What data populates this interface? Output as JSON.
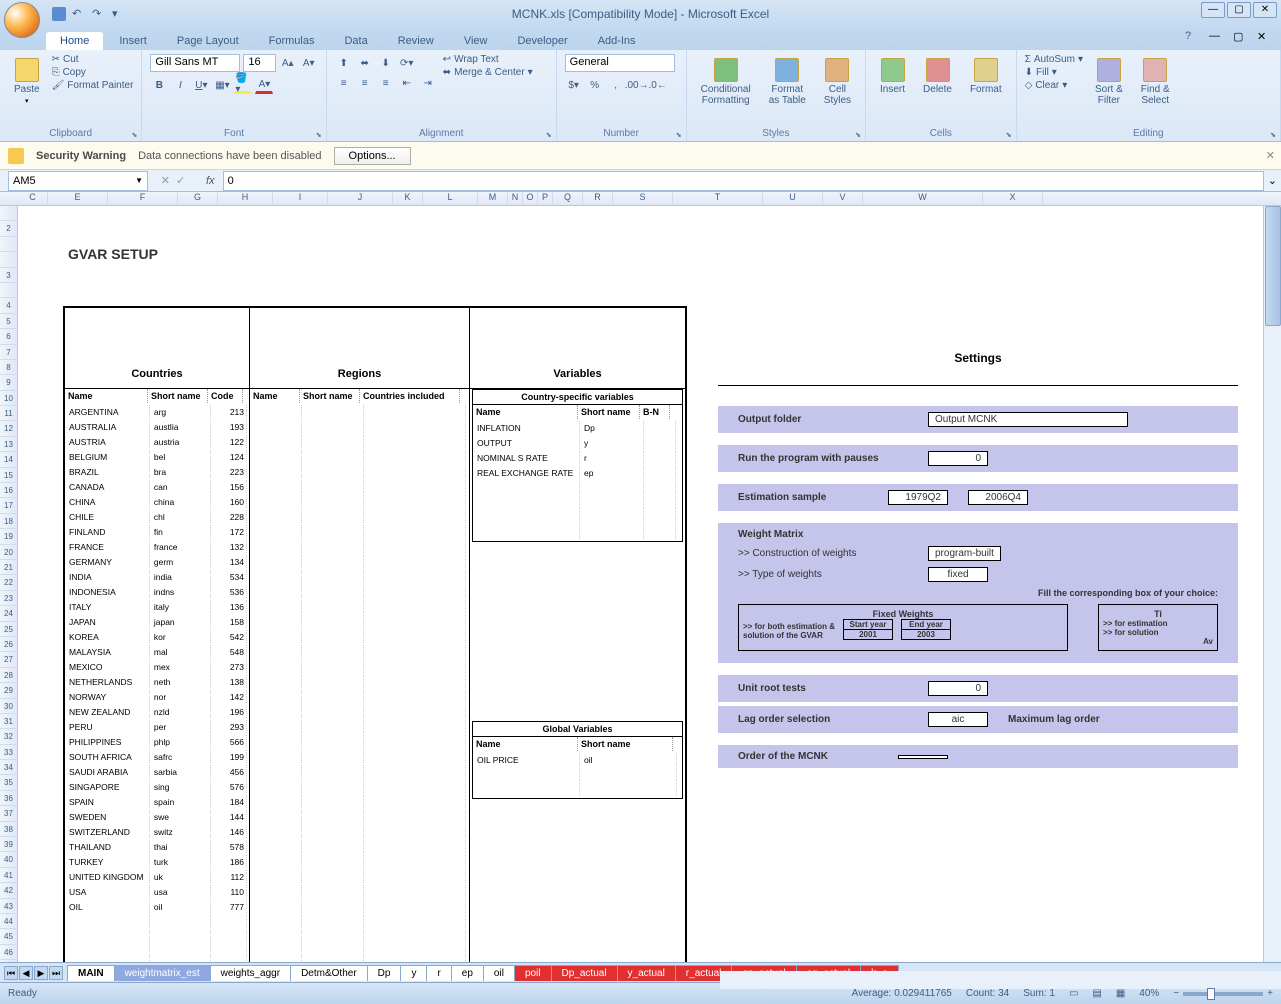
{
  "title": "MCNK.xls  [Compatibility Mode] - Microsoft Excel",
  "tabs": [
    "Home",
    "Insert",
    "Page Layout",
    "Formulas",
    "Data",
    "Review",
    "View",
    "Developer",
    "Add-Ins"
  ],
  "active_tab": "Home",
  "ribbon": {
    "clipboard": {
      "label": "Clipboard",
      "paste": "Paste",
      "cut": "Cut",
      "copy": "Copy",
      "format_painter": "Format Painter"
    },
    "font": {
      "label": "Font",
      "family": "Gill Sans MT",
      "size": "16"
    },
    "alignment": {
      "label": "Alignment",
      "wrap": "Wrap Text",
      "merge": "Merge & Center"
    },
    "number": {
      "label": "Number",
      "format": "General"
    },
    "styles": {
      "label": "Styles",
      "cond": "Conditional\nFormatting",
      "table": "Format\nas Table",
      "cell": "Cell\nStyles"
    },
    "cells": {
      "label": "Cells",
      "insert": "Insert",
      "delete": "Delete",
      "format": "Format"
    },
    "editing": {
      "label": "Editing",
      "autosum": "AutoSum",
      "fill": "Fill",
      "clear": "Clear",
      "sort": "Sort &\nFilter",
      "find": "Find &\nSelect"
    }
  },
  "security": {
    "title": "Security Warning",
    "msg": "Data connections have been disabled",
    "btn": "Options..."
  },
  "namebox": "AM5",
  "formula": "0",
  "sheet": {
    "title": "GVAR SETUP",
    "countries": {
      "header": "Countries",
      "cols": [
        "Name",
        "Short name",
        "Code"
      ],
      "rows": [
        [
          "ARGENTINA",
          "arg",
          "213"
        ],
        [
          "AUSTRALIA",
          "austlia",
          "193"
        ],
        [
          "AUSTRIA",
          "austria",
          "122"
        ],
        [
          "BELGIUM",
          "bel",
          "124"
        ],
        [
          "BRAZIL",
          "bra",
          "223"
        ],
        [
          "CANADA",
          "can",
          "156"
        ],
        [
          "CHINA",
          "china",
          "160"
        ],
        [
          "CHILE",
          "chl",
          "228"
        ],
        [
          "FINLAND",
          "fin",
          "172"
        ],
        [
          "FRANCE",
          "france",
          "132"
        ],
        [
          "GERMANY",
          "germ",
          "134"
        ],
        [
          "INDIA",
          "india",
          "534"
        ],
        [
          "INDONESIA",
          "indns",
          "536"
        ],
        [
          "ITALY",
          "italy",
          "136"
        ],
        [
          "JAPAN",
          "japan",
          "158"
        ],
        [
          "KOREA",
          "kor",
          "542"
        ],
        [
          "MALAYSIA",
          "mal",
          "548"
        ],
        [
          "MEXICO",
          "mex",
          "273"
        ],
        [
          "NETHERLANDS",
          "neth",
          "138"
        ],
        [
          "NORWAY",
          "nor",
          "142"
        ],
        [
          "NEW ZEALAND",
          "nzld",
          "196"
        ],
        [
          "PERU",
          "per",
          "293"
        ],
        [
          "PHILIPPINES",
          "phlp",
          "566"
        ],
        [
          "SOUTH AFRICA",
          "safrc",
          "199"
        ],
        [
          "SAUDI ARABIA",
          "sarbia",
          "456"
        ],
        [
          "SINGAPORE",
          "sing",
          "576"
        ],
        [
          "SPAIN",
          "spain",
          "184"
        ],
        [
          "SWEDEN",
          "swe",
          "144"
        ],
        [
          "SWITZERLAND",
          "switz",
          "146"
        ],
        [
          "THAILAND",
          "thai",
          "578"
        ],
        [
          "TURKEY",
          "turk",
          "186"
        ],
        [
          "UNITED KINGDOM",
          "uk",
          "112"
        ],
        [
          "USA",
          "usa",
          "110"
        ],
        [
          "OIL",
          "oil",
          "777"
        ]
      ]
    },
    "regions": {
      "header": "Regions",
      "cols": [
        "Name",
        "Short name",
        "Countries included"
      ]
    },
    "variables": {
      "header": "Variables",
      "cs_header": "Country-specific variables",
      "cs_cols": [
        "Name",
        "Short name",
        "B-N"
      ],
      "cs_rows": [
        [
          "INFLATION",
          "Dp"
        ],
        [
          "OUTPUT",
          "y"
        ],
        [
          "NOMINAL S RATE",
          "r"
        ],
        [
          "REAL EXCHANGE RATE",
          "ep"
        ]
      ],
      "gv_header": "Global Variables",
      "gv_cols": [
        "Name",
        "Short name"
      ],
      "gv_rows": [
        [
          "OIL PRICE",
          "oil"
        ]
      ]
    },
    "settings": {
      "header": "Settings",
      "output_folder_label": "Output folder",
      "output_folder": "Output MCNK",
      "pauses_label": "Run the program with pauses",
      "pauses": "0",
      "est_label": "Estimation sample",
      "est_start": "1979Q2",
      "est_end": "2006Q4",
      "wm_header": "Weight Matrix",
      "constr_label": ">> Construction of weights",
      "constr": "program-built",
      "type_label": ">> Type of weights",
      "type": "fixed",
      "fill_msg": "Fill the corresponding box of your choice:",
      "fw_header": "Fixed Weights",
      "fw_sub": ">> for both estimation &\nsolution of the GVAR",
      "start_year_label": "Start year",
      "start_year": "2001",
      "end_year_label": "End year",
      "end_year": "2003",
      "ti_header": "Ti",
      "ti_est": ">> for estimation",
      "ti_sol": ">> for solution",
      "ti_av": "Av",
      "unit_label": "Unit root tests",
      "unit": "0",
      "lag_label": "Lag order selection",
      "lag": "aic",
      "max_lag": "Maximum lag order",
      "order_label": "Order of the MCNK"
    }
  },
  "sheet_tabs": {
    "active": "MAIN",
    "tabs": [
      {
        "name": "MAIN",
        "cls": "active"
      },
      {
        "name": "weightmatrix_est",
        "cls": "blue"
      },
      {
        "name": "weights_aggr",
        "cls": ""
      },
      {
        "name": "Detm&Other",
        "cls": ""
      },
      {
        "name": "Dp",
        "cls": ""
      },
      {
        "name": "y",
        "cls": ""
      },
      {
        "name": "r",
        "cls": ""
      },
      {
        "name": "ep",
        "cls": ""
      },
      {
        "name": "oil",
        "cls": ""
      },
      {
        "name": "poil",
        "cls": "red"
      },
      {
        "name": "Dp_actual",
        "cls": "red"
      },
      {
        "name": "y_actual",
        "cls": "red"
      },
      {
        "name": "r_actual",
        "cls": "red"
      },
      {
        "name": "ep_actual",
        "cls": "red"
      },
      {
        "name": "eq_actual",
        "cls": "red"
      },
      {
        "name": "lr_a",
        "cls": "red"
      }
    ]
  },
  "status": {
    "ready": "Ready",
    "avg_label": "Average:",
    "avg": "0.029411765",
    "count_label": "Count:",
    "count": "34",
    "sum_label": "Sum:",
    "sum": "1",
    "zoom": "40%"
  }
}
